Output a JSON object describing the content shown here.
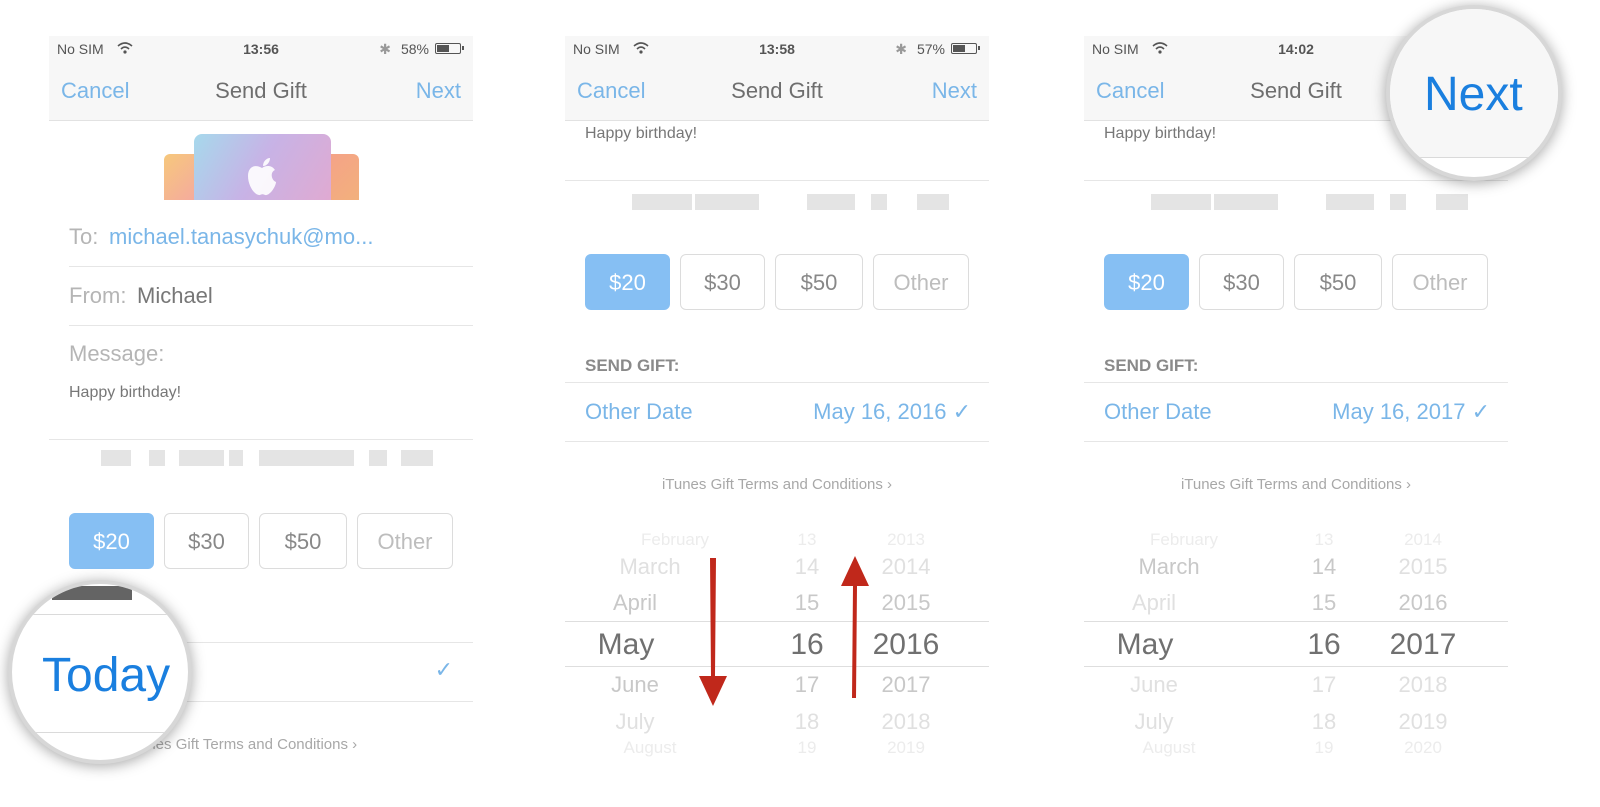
{
  "panels": [
    {
      "status": {
        "carrier": "No SIM",
        "time": "13:56",
        "battery_pct": "58%",
        "battery_level": 0.58
      },
      "nav": {
        "cancel": "Cancel",
        "title": "Send Gift",
        "next": "Next"
      },
      "to_label": "To:",
      "to_value": "michael.tanasychuk@mo...",
      "from_label": "From:",
      "from_value": "Michael",
      "message_label": "Message:",
      "message_value": "Happy birthday!",
      "amounts": [
        "$20",
        "$30",
        "$50",
        "Other"
      ],
      "selected_amount": "$20",
      "send_date_value": "Today",
      "terms": "iTunes Gift Terms and Conditions ›",
      "terms_partial": "unes Gift Terms and Conditions ›",
      "zoom_label": "Today"
    },
    {
      "status": {
        "carrier": "No SIM",
        "time": "13:58",
        "battery_pct": "57%",
        "battery_level": 0.57
      },
      "nav": {
        "cancel": "Cancel",
        "title": "Send Gift",
        "next": "Next"
      },
      "message_value": "Happy birthday!",
      "amounts": [
        "$20",
        "$30",
        "$50",
        "Other"
      ],
      "send_gift_header": "SEND GIFT:",
      "date_label": "Other Date",
      "date_value": "May 16, 2016 ✓",
      "terms": "iTunes Gift Terms and Conditions ›",
      "picker": {
        "months": [
          "February",
          "March",
          "April",
          "May",
          "June",
          "July",
          "August"
        ],
        "days": [
          "13",
          "14",
          "15",
          "16",
          "17",
          "18",
          "19"
        ],
        "years": [
          "2013",
          "2014",
          "2015",
          "2016",
          "2017",
          "2018",
          "2019"
        ]
      }
    },
    {
      "status": {
        "carrier": "No SIM",
        "time": "14:02"
      },
      "nav": {
        "cancel": "Cancel",
        "title": "Send Gift",
        "next": "Next"
      },
      "message_value": "Happy birthday!",
      "amounts": [
        "$20",
        "$30",
        "$50",
        "Other"
      ],
      "send_gift_header": "SEND GIFT:",
      "date_label": "Other Date",
      "date_value": "May 16, 2017 ✓",
      "terms": "iTunes Gift Terms and Conditions ›",
      "picker": {
        "months": [
          "February",
          "March",
          "April",
          "May",
          "June",
          "July",
          "August"
        ],
        "days": [
          "13",
          "14",
          "15",
          "16",
          "17",
          "18",
          "19"
        ],
        "years": [
          "2014",
          "2015",
          "2016",
          "2017",
          "2018",
          "2019",
          "2020"
        ]
      },
      "zoom_label": "Next"
    }
  ],
  "colors": {
    "accent": "#7ab6e8",
    "selected_amount_bg": "#86bff3",
    "zoom_text": "#1a7fdf",
    "arrow": "#c0281b"
  },
  "icons": [
    "wifi-icon",
    "bluetooth-icon",
    "battery-icon",
    "apple-logo-icon",
    "checkmark-icon",
    "arrow-down-icon",
    "arrow-up-icon"
  ]
}
